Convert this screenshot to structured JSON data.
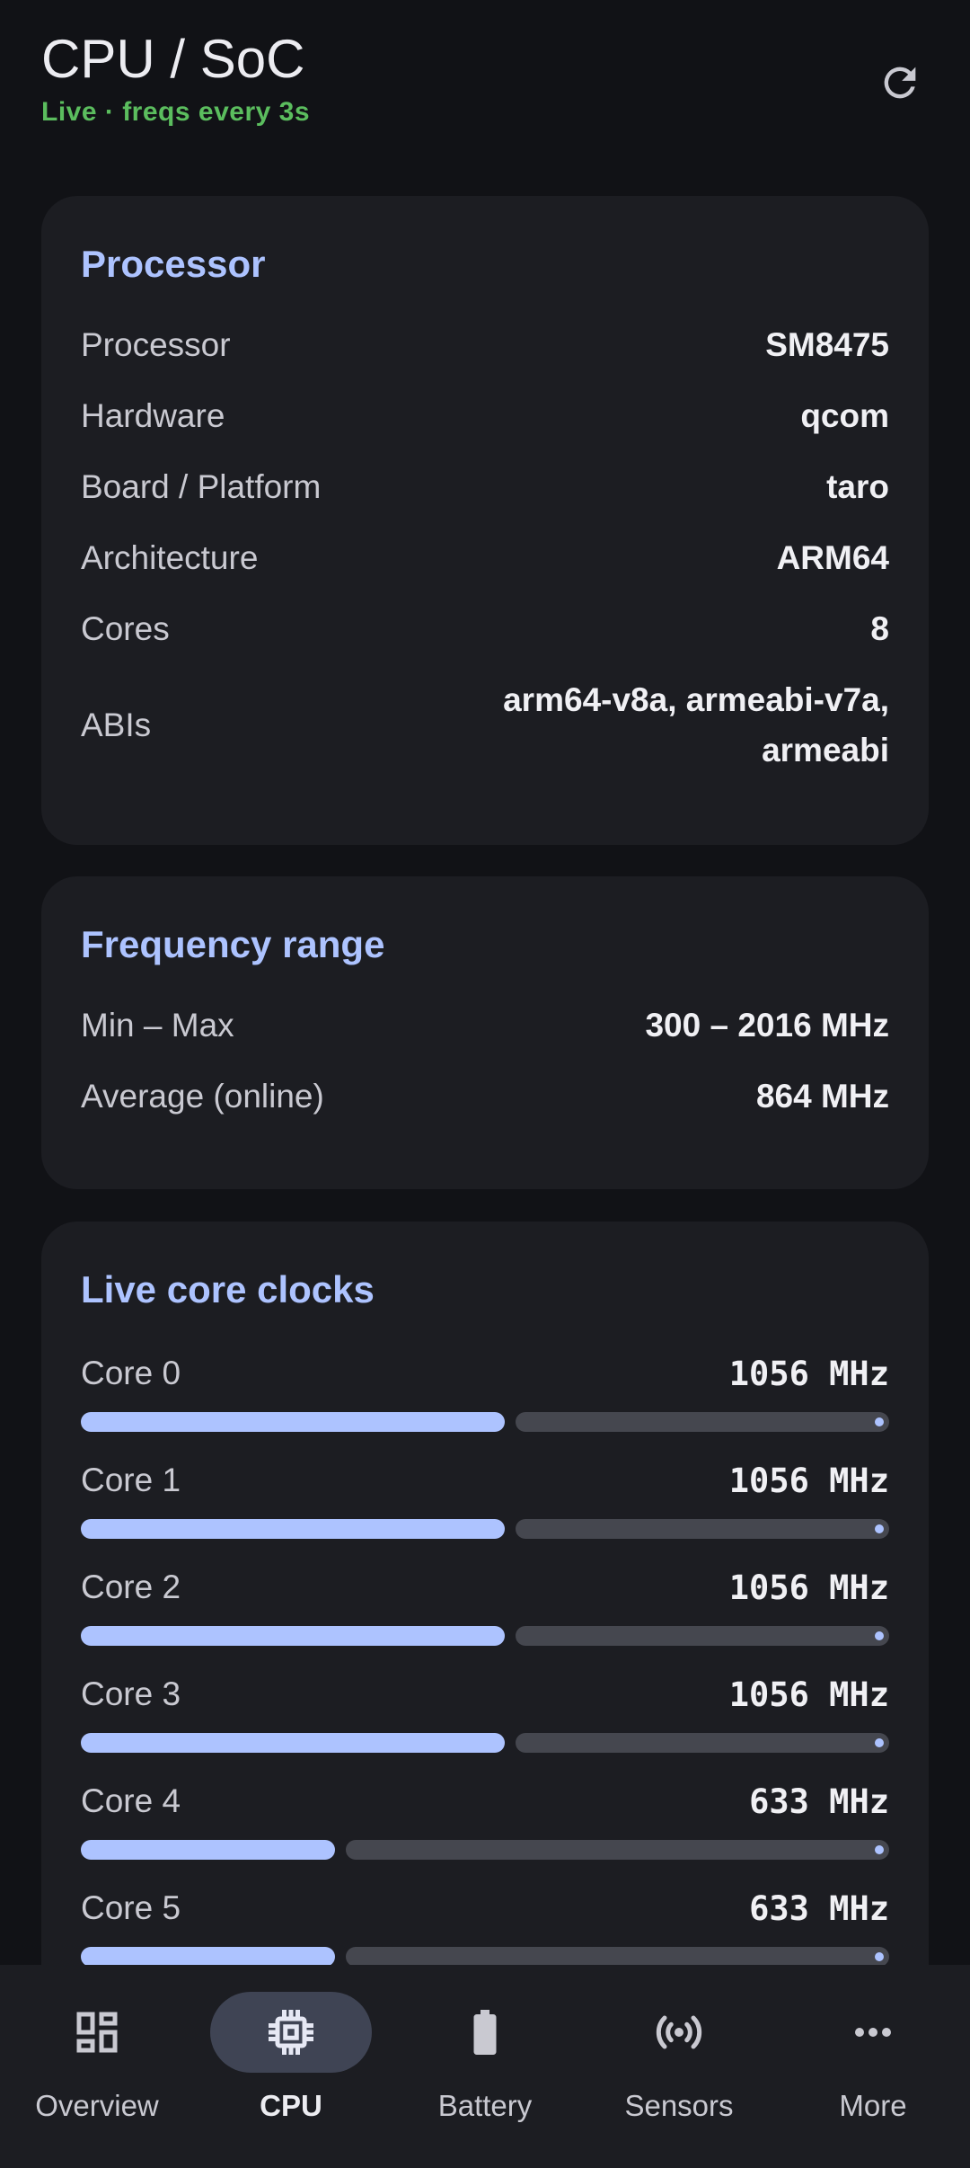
{
  "header": {
    "title": "CPU / SoC",
    "subtitle": "Live · freqs every 3s"
  },
  "processor": {
    "title": "Processor",
    "rows": [
      {
        "label": "Processor",
        "value": "SM8475"
      },
      {
        "label": "Hardware",
        "value": "qcom"
      },
      {
        "label": "Board / Platform",
        "value": "taro"
      },
      {
        "label": "Architecture",
        "value": "ARM64"
      },
      {
        "label": "Cores",
        "value": "8"
      }
    ],
    "abis": {
      "label": "ABIs",
      "value_line1": "arm64-v8a, armeabi-v7a,",
      "value_line2": "armeabi"
    }
  },
  "frequency": {
    "title": "Frequency range",
    "rows": [
      {
        "label": "Min – Max",
        "value": "300 – 2016 MHz"
      },
      {
        "label": "Average (online)",
        "value": "864 MHz"
      }
    ]
  },
  "cores": {
    "title": "Live core clocks",
    "items": [
      {
        "label": "Core 0",
        "value": "1056 MHz",
        "level": 0.524
      },
      {
        "label": "Core 1",
        "value": "1056 MHz",
        "level": 0.524
      },
      {
        "label": "Core 2",
        "value": "1056 MHz",
        "level": 0.524
      },
      {
        "label": "Core 3",
        "value": "1056 MHz",
        "level": 0.524
      },
      {
        "label": "Core 4",
        "value": "633 MHz",
        "level": 0.314
      },
      {
        "label": "Core 5",
        "value": "633 MHz",
        "level": 0.314
      }
    ]
  },
  "nav": {
    "items": [
      {
        "label": "Overview",
        "icon": "dashboard-icon",
        "active": false
      },
      {
        "label": "CPU",
        "icon": "chip-icon",
        "active": true
      },
      {
        "label": "Battery",
        "icon": "battery-icon",
        "active": false
      },
      {
        "label": "Sensors",
        "icon": "sensors-icon",
        "active": false
      },
      {
        "label": "More",
        "icon": "more-horizontal-icon",
        "active": false
      }
    ]
  },
  "colors": {
    "accent": "#adc3ff",
    "live": "#5bbd5e",
    "background": "#111216",
    "card": "#1c1d22"
  }
}
